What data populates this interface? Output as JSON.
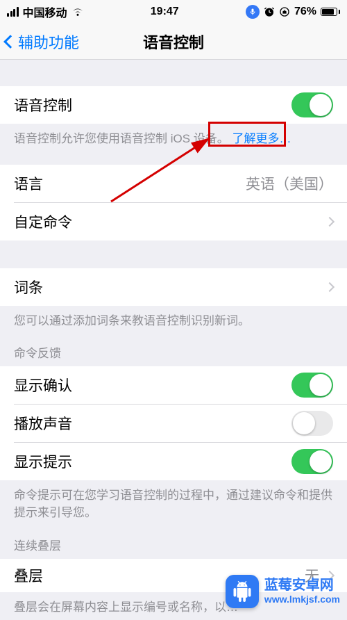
{
  "status": {
    "carrier": "中国移动",
    "time": "19:47",
    "battery_pct": "76%"
  },
  "nav": {
    "back_label": "辅助功能",
    "title": "语音控制"
  },
  "main_toggle": {
    "label": "语音控制",
    "on": true,
    "footer": "语音控制允许您使用语音控制 iOS 设备。",
    "learn_more": "了解更多…"
  },
  "language": {
    "label": "语言",
    "value": "英语（美国）"
  },
  "custom_commands": {
    "label": "自定命令"
  },
  "vocabulary": {
    "label": "词条",
    "footer": "您可以通过添加词条来教语音控制识别新词。"
  },
  "feedback_section": {
    "header": "命令反馈",
    "show_confirm": {
      "label": "显示确认",
      "on": true
    },
    "play_sound": {
      "label": "播放声音",
      "on": false
    },
    "show_hints": {
      "label": "显示提示",
      "on": true
    },
    "footer": "命令提示可在您学习语音控制的过程中，通过建议命令和提供提示来引导您。"
  },
  "overlay_section": {
    "header": "连续叠层",
    "overlay": {
      "label": "叠层",
      "value": "无"
    },
    "footer": "叠层会在屏幕内容上显示编号或名称，以…"
  },
  "watermark": {
    "name": "蓝莓安卓网",
    "url": "www.lmkjsf.com"
  }
}
